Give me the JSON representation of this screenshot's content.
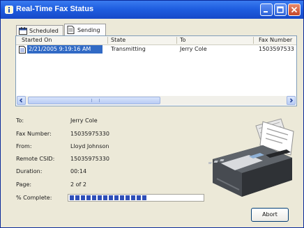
{
  "window": {
    "title": "Real-Time Fax Status"
  },
  "tabs": [
    {
      "label": "Scheduled"
    },
    {
      "label": "Sending"
    }
  ],
  "list": {
    "columns": [
      "Started On",
      "State",
      "To",
      "Fax Number"
    ],
    "rows": [
      [
        "2/21/2005 9:19:16 AM",
        "Transmitting",
        "Jerry Cole",
        "1503597533"
      ]
    ]
  },
  "details": {
    "to_label": "To:",
    "to_value": "Jerry Cole",
    "fax_label": "Fax Number:",
    "fax_value": "15035975330",
    "from_label": "From:",
    "from_value": "Lloyd Johnson",
    "csid_label": "Remote CSID:",
    "csid_value": "15035975330",
    "duration_label": "Duration:",
    "duration_value": "00:14",
    "page_label": "Page:",
    "page_value": "2 of 2",
    "complete_label": "% Complete:",
    "complete_fraction": 0.58
  },
  "buttons": {
    "abort": "Abort"
  },
  "colors": {
    "titlebar": "#1f5ee0",
    "selection": "#316ac5",
    "progress": "#2f4fb8"
  }
}
